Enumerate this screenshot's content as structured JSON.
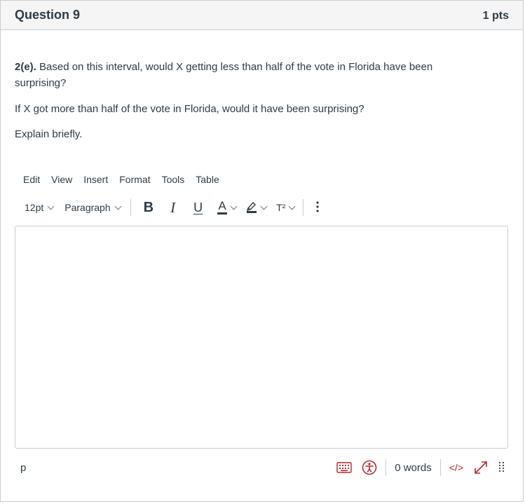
{
  "question": {
    "title": "Question 9",
    "points": "1 pts",
    "label": "2(e).",
    "text1": " Based on this interval, would X getting less than half of the vote in Florida have been surprising?",
    "text2": "If X got more than half of the vote in Florida, would it have been surprising?",
    "text3": "Explain briefly."
  },
  "editor": {
    "menu": [
      "Edit",
      "View",
      "Insert",
      "Format",
      "Tools",
      "Table"
    ],
    "font_size": "12pt",
    "block_format": "Paragraph",
    "toolbar_icons": [
      "bold-icon",
      "italic-icon",
      "underline-icon",
      "text-color-icon",
      "highlight-icon",
      "superscript-icon",
      "more-icon"
    ],
    "bold_glyph": "B",
    "italic_glyph": "I",
    "underline_glyph": "U",
    "color_glyph": "A",
    "superscript_glyph": "T²",
    "content": "",
    "path": "p",
    "word_count": "0 words",
    "html_toggle": "</>",
    "accent_color": "#c4314b",
    "red_icon_color": "#b5282d",
    "status_icons": [
      "keyboard-shortcuts-icon",
      "accessibility-checker-icon",
      "html-editor-icon",
      "fullscreen-icon",
      "resize-handle-icon"
    ]
  }
}
